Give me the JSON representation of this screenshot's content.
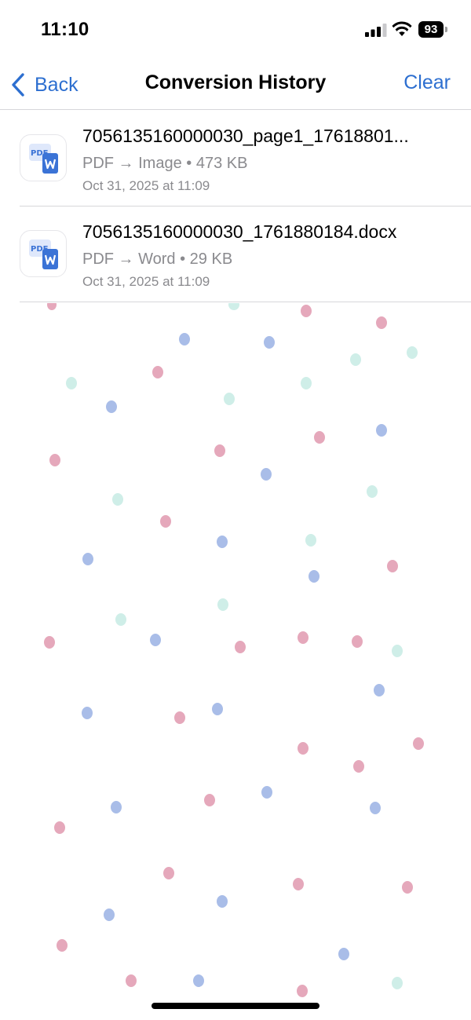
{
  "status_bar": {
    "time": "11:10",
    "battery": "93"
  },
  "nav": {
    "back_label": "Back",
    "title": "Conversion History",
    "clear_label": "Clear"
  },
  "history": [
    {
      "filename": "7056135160000030_page1_17618801...",
      "conversion": "PDF → Image",
      "size": "473 KB",
      "date": "Oct 31, 2025 at 11:09",
      "icon": "pdf-convert-icon"
    },
    {
      "filename": "7056135160000030_1761880184.docx",
      "conversion": "PDF → Word",
      "size": "29 KB",
      "date": "Oct 31, 2025 at 11:09",
      "icon": "pdf-convert-icon"
    }
  ],
  "colors": {
    "accent": "#2d6fd0",
    "secondary_text": "#8a8a8e",
    "dot_pink": "#e5a8bb",
    "dot_blue": "#a9bde8",
    "dot_teal": "#cfeee8"
  }
}
